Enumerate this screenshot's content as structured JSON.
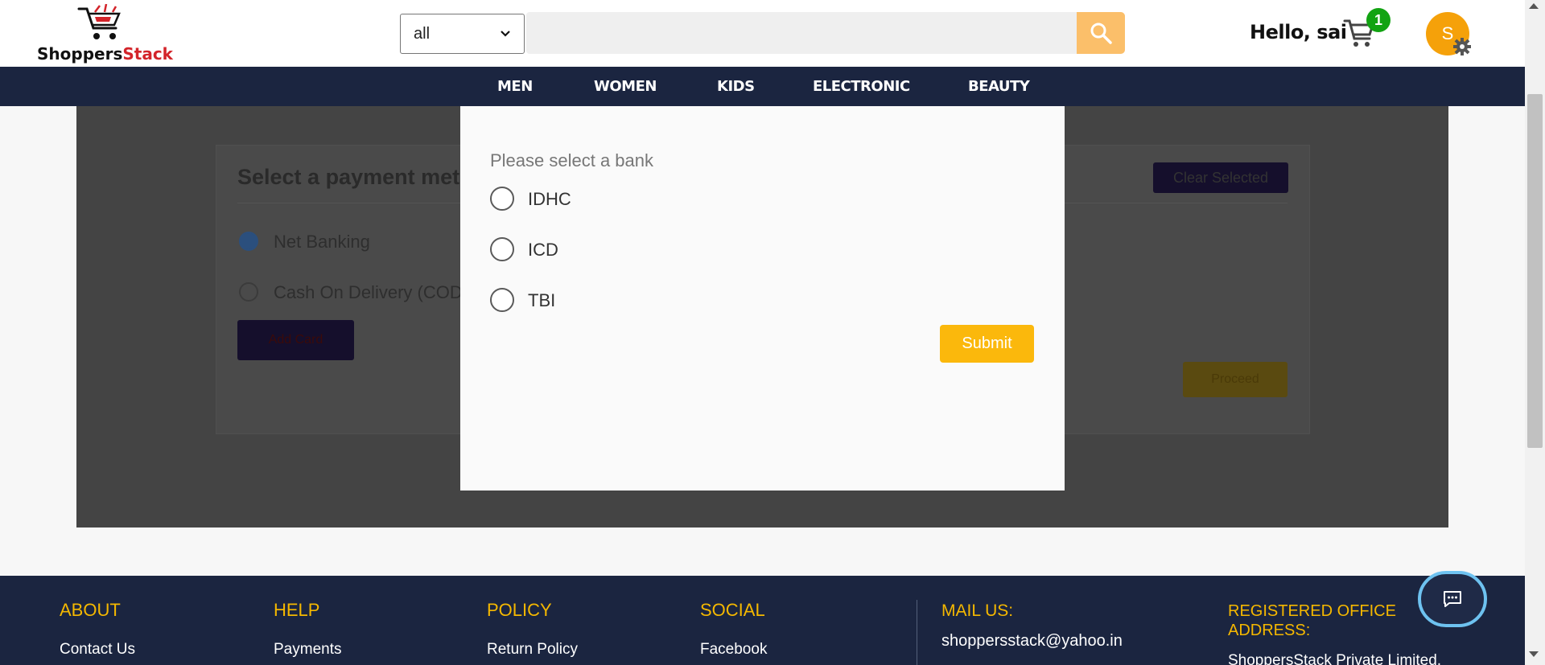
{
  "header": {
    "logo": {
      "part1": "Shoppers",
      "part2": "Stack"
    },
    "category_select": {
      "value": "all"
    },
    "search": {
      "placeholder": ""
    },
    "greeting": "Hello, sai",
    "cart_count": "1",
    "avatar_initial": "S"
  },
  "nav": {
    "items": [
      {
        "label": "MEN"
      },
      {
        "label": "WOMEN"
      },
      {
        "label": "KIDS"
      },
      {
        "label": "ELECTRONIC"
      },
      {
        "label": "BEAUTY"
      }
    ]
  },
  "payment": {
    "title": "Select a payment method",
    "clear_label": "Clear Selected",
    "options": [
      {
        "label": "Net Banking",
        "selected": true
      },
      {
        "label": "Cash On Delivery (COD)",
        "selected": false
      }
    ],
    "back_label": "Add Card",
    "proceed_label": "Proceed"
  },
  "modal": {
    "title": "Please select a bank",
    "banks": [
      {
        "label": "IDHC"
      },
      {
        "label": "ICD"
      },
      {
        "label": "TBI"
      }
    ],
    "submit_label": "Submit"
  },
  "footer": {
    "about": {
      "heading": "ABOUT",
      "link": "Contact Us"
    },
    "help": {
      "heading": "HELP",
      "link": "Payments"
    },
    "policy": {
      "heading": "POLICY",
      "link": "Return Policy"
    },
    "social": {
      "heading": "SOCIAL",
      "link": "Facebook"
    },
    "mail": {
      "heading": "MAIL US:",
      "email": "shoppersstack@yahoo.in"
    },
    "office": {
      "heading": "REGISTERED OFFICE ADDRESS:",
      "text": "ShoppersStack Private Limited,"
    }
  },
  "colors": {
    "brand_red": "#d3242a",
    "accent_yellow": "#fbb80c",
    "nav_navy": "#1b2540",
    "cart_badge": "#12a312",
    "avatar": "#f5a10a"
  }
}
